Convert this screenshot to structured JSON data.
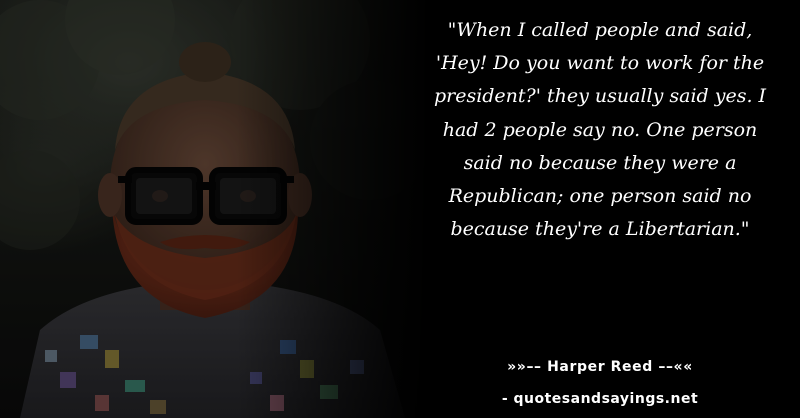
{
  "quote": {
    "text": "\"When I called people and said, 'Hey! Do you want to work for the president?' they usually said yes. I had 2 people say no. One person said no because they were a Republican; one person said no because they're a Libertarian.\""
  },
  "attribution": {
    "author_line": "»»–– Harper Reed ––««",
    "source_line": "- quotesandsayings.net"
  },
  "colors": {
    "background": "#000000",
    "text": "#ffffff",
    "beard": "#8a3a22",
    "glasses": "#050505"
  }
}
